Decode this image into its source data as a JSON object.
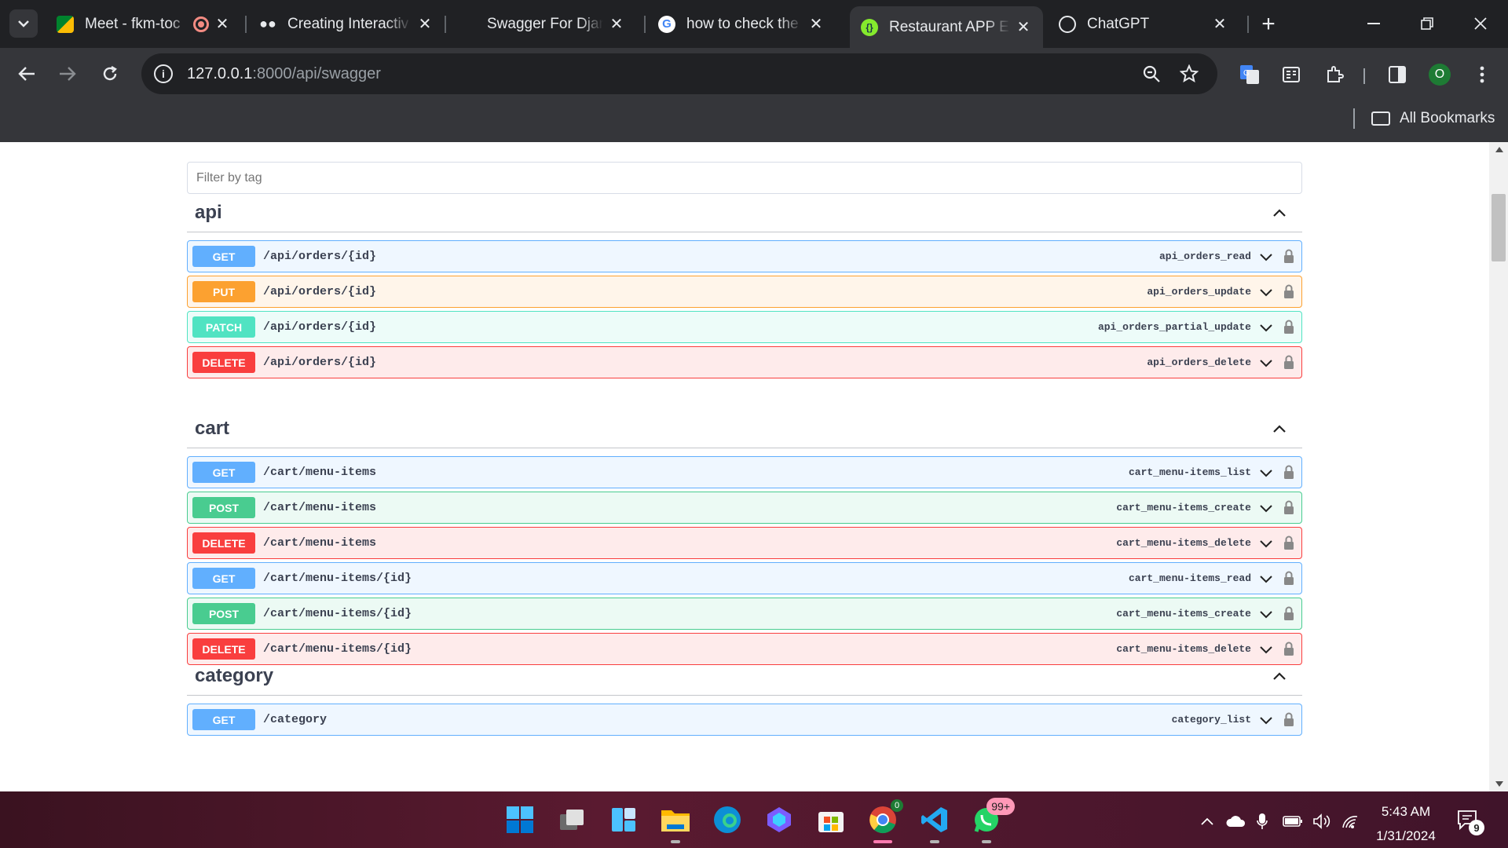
{
  "browser": {
    "tabs": [
      {
        "title": "Meet - fkm-toc",
        "icon": "google-meet-icon"
      },
      {
        "title": "Creating Interactiv",
        "icon": "medium-icon"
      },
      {
        "title": "Swagger For Djang",
        "icon": "blank-page-icon"
      },
      {
        "title": "how to check the v",
        "icon": "google-icon"
      },
      {
        "title": "Restaurant APP EN",
        "icon": "swagger-icon",
        "active": true
      },
      {
        "title": "ChatGPT",
        "icon": "chatgpt-icon"
      }
    ],
    "address": {
      "host": "127.0.0.1",
      "rest": ":8000/api/swagger"
    },
    "profile_initial": "O",
    "bookmarks_label": "All Bookmarks"
  },
  "swagger": {
    "filter_placeholder": "Filter by tag",
    "sections": [
      {
        "tag": "api",
        "operations": [
          {
            "method": "GET",
            "path": "/api/orders/{id}",
            "operation_id": "api_orders_read"
          },
          {
            "method": "PUT",
            "path": "/api/orders/{id}",
            "operation_id": "api_orders_update"
          },
          {
            "method": "PATCH",
            "path": "/api/orders/{id}",
            "operation_id": "api_orders_partial_update"
          },
          {
            "method": "DELETE",
            "path": "/api/orders/{id}",
            "operation_id": "api_orders_delete"
          }
        ]
      },
      {
        "tag": "cart",
        "operations": [
          {
            "method": "GET",
            "path": "/cart/menu-items",
            "operation_id": "cart_menu-items_list"
          },
          {
            "method": "POST",
            "path": "/cart/menu-items",
            "operation_id": "cart_menu-items_create"
          },
          {
            "method": "DELETE",
            "path": "/cart/menu-items",
            "operation_id": "cart_menu-items_delete"
          },
          {
            "method": "GET",
            "path": "/cart/menu-items/{id}",
            "operation_id": "cart_menu-items_read"
          },
          {
            "method": "POST",
            "path": "/cart/menu-items/{id}",
            "operation_id": "cart_menu-items_create"
          },
          {
            "method": "DELETE",
            "path": "/cart/menu-items/{id}",
            "operation_id": "cart_menu-items_delete"
          }
        ]
      },
      {
        "tag": "category",
        "operations": [
          {
            "method": "GET",
            "path": "/category",
            "operation_id": "category_list"
          }
        ]
      }
    ],
    "method_colors": {
      "GET": "#61affe",
      "PUT": "#fca130",
      "PATCH": "#50e3c2",
      "DELETE": "#f93e3e",
      "POST": "#49cc90"
    }
  },
  "taskbar": {
    "chrome_badge": "0",
    "whatsapp_badge": "99+",
    "time": "5:43 AM",
    "date": "1/31/2024",
    "notifications": "9"
  }
}
